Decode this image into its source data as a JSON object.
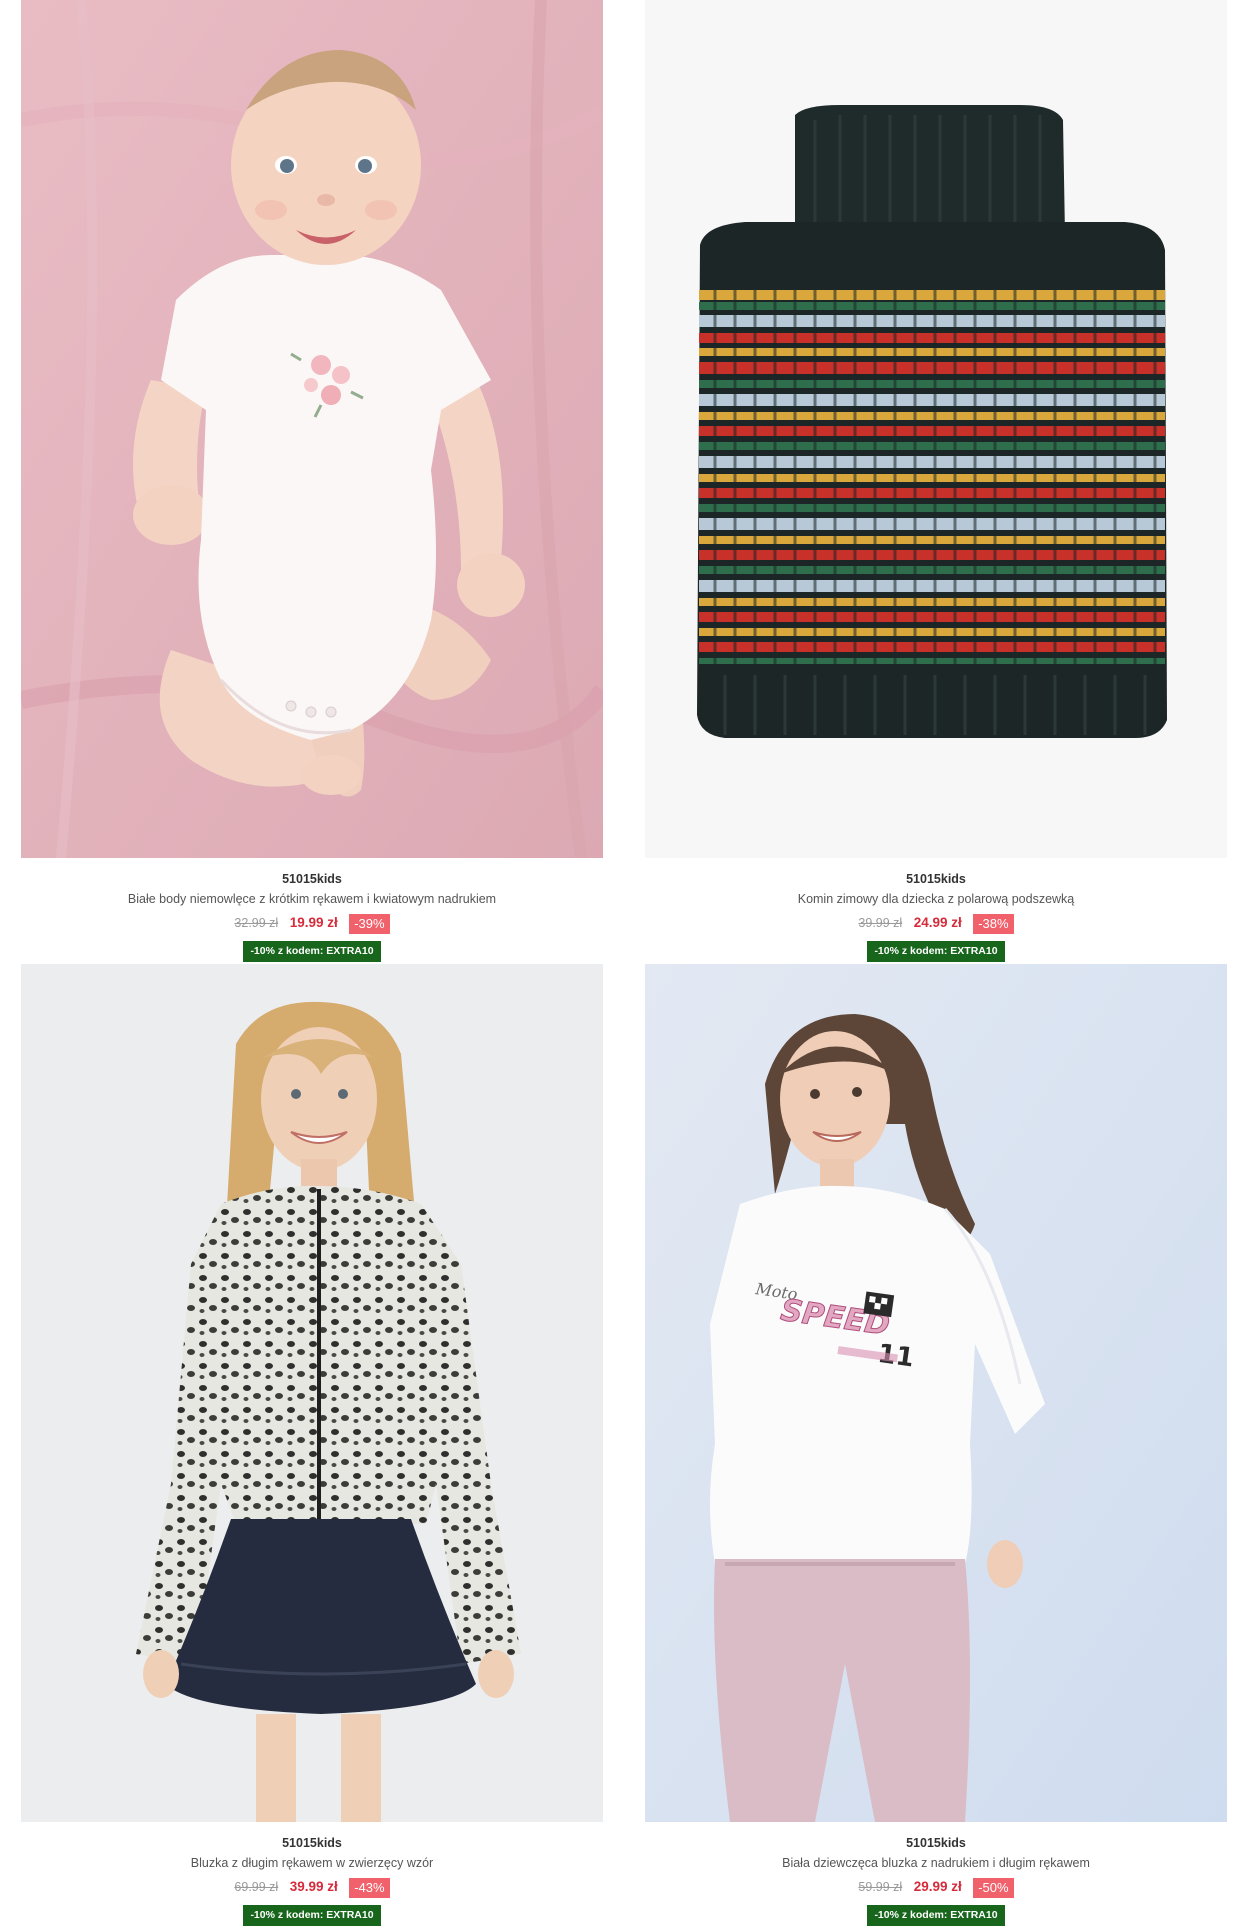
{
  "products": [
    {
      "brand": "51015kids",
      "name": "Białe body niemowlęce z krótkim rękawem i kwiatowym nadrukiem",
      "old_price": "32.99 zł",
      "new_price": "19.99 zł",
      "discount": "-39%",
      "promo": "-10% z kodem: EXTRA10",
      "image": "baby-bodysuit-photo"
    },
    {
      "brand": "51015kids",
      "name": "Komin zimowy dla dziecka z polarową podszewką",
      "old_price": "39.99 zł",
      "new_price": "24.99 zł",
      "discount": "-38%",
      "promo": "-10% z kodem: EXTRA10",
      "image": "knitted-neck-warmer-photo"
    },
    {
      "brand": "51015kids",
      "name": "Bluzka z długim rękawem w zwierzęcy wzór",
      "old_price": "69.99 zł",
      "new_price": "39.99 zł",
      "discount": "-43%",
      "promo": "-10% z kodem: EXTRA10",
      "image": "animal-print-blouse-photo"
    },
    {
      "brand": "51015kids",
      "name": "Biała dziewczęca bluzka z nadrukiem i długim rękawem",
      "old_price": "59.99 zł",
      "new_price": "29.99 zł",
      "discount": "-50%",
      "promo": "-10% z kodem: EXTRA10",
      "image": "white-print-longsleeve-photo"
    }
  ],
  "print_text": {
    "line1": "SPEED",
    "line2": "11"
  },
  "colors": {
    "price_red": "#d52b3a",
    "discount_bg": "#f0616b",
    "promo_bg": "#17661c",
    "old_price": "#9a9a9a"
  }
}
